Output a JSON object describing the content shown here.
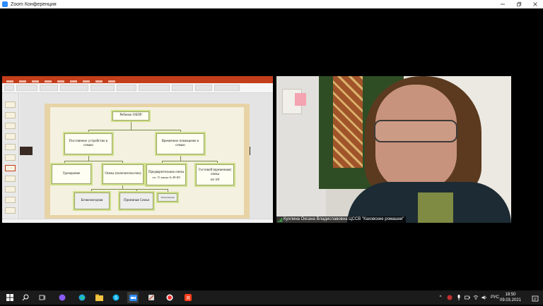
{
  "window": {
    "title": "Zoom Конференция"
  },
  "participant": {
    "name": "Кухлина Оксана Владиславовна ЦССВ \"Каховские ромашки\""
  },
  "slide": {
    "root": "Ребенок ОБПР",
    "left_branch": "Постоянное устройство в семью",
    "right_branch": "Временное помещение в семью",
    "adoption": "Удочерение",
    "guardianship": "Опека (попечительство)",
    "prelim": "Предварительная опека",
    "prelim_note": "ст. 13 закона № 48-ФЗ",
    "guest": "Гостевой (временная) опека",
    "guest_note": "661 ПП",
    "free": "Безвозмездная",
    "foster": "Приемная Семья",
    "patronage": "Патронатная"
  },
  "taskbar": {
    "lang": "РУС",
    "time": "18:50",
    "date": "09.03.2021",
    "chevron": "^"
  },
  "colors": {
    "zoom_blue": "#2d8cff",
    "ppt_red": "#c43e1c",
    "taskbar": "#1b1b1b",
    "slide_frame": "#e7d3a6",
    "box_border": "#cfe08a"
  }
}
